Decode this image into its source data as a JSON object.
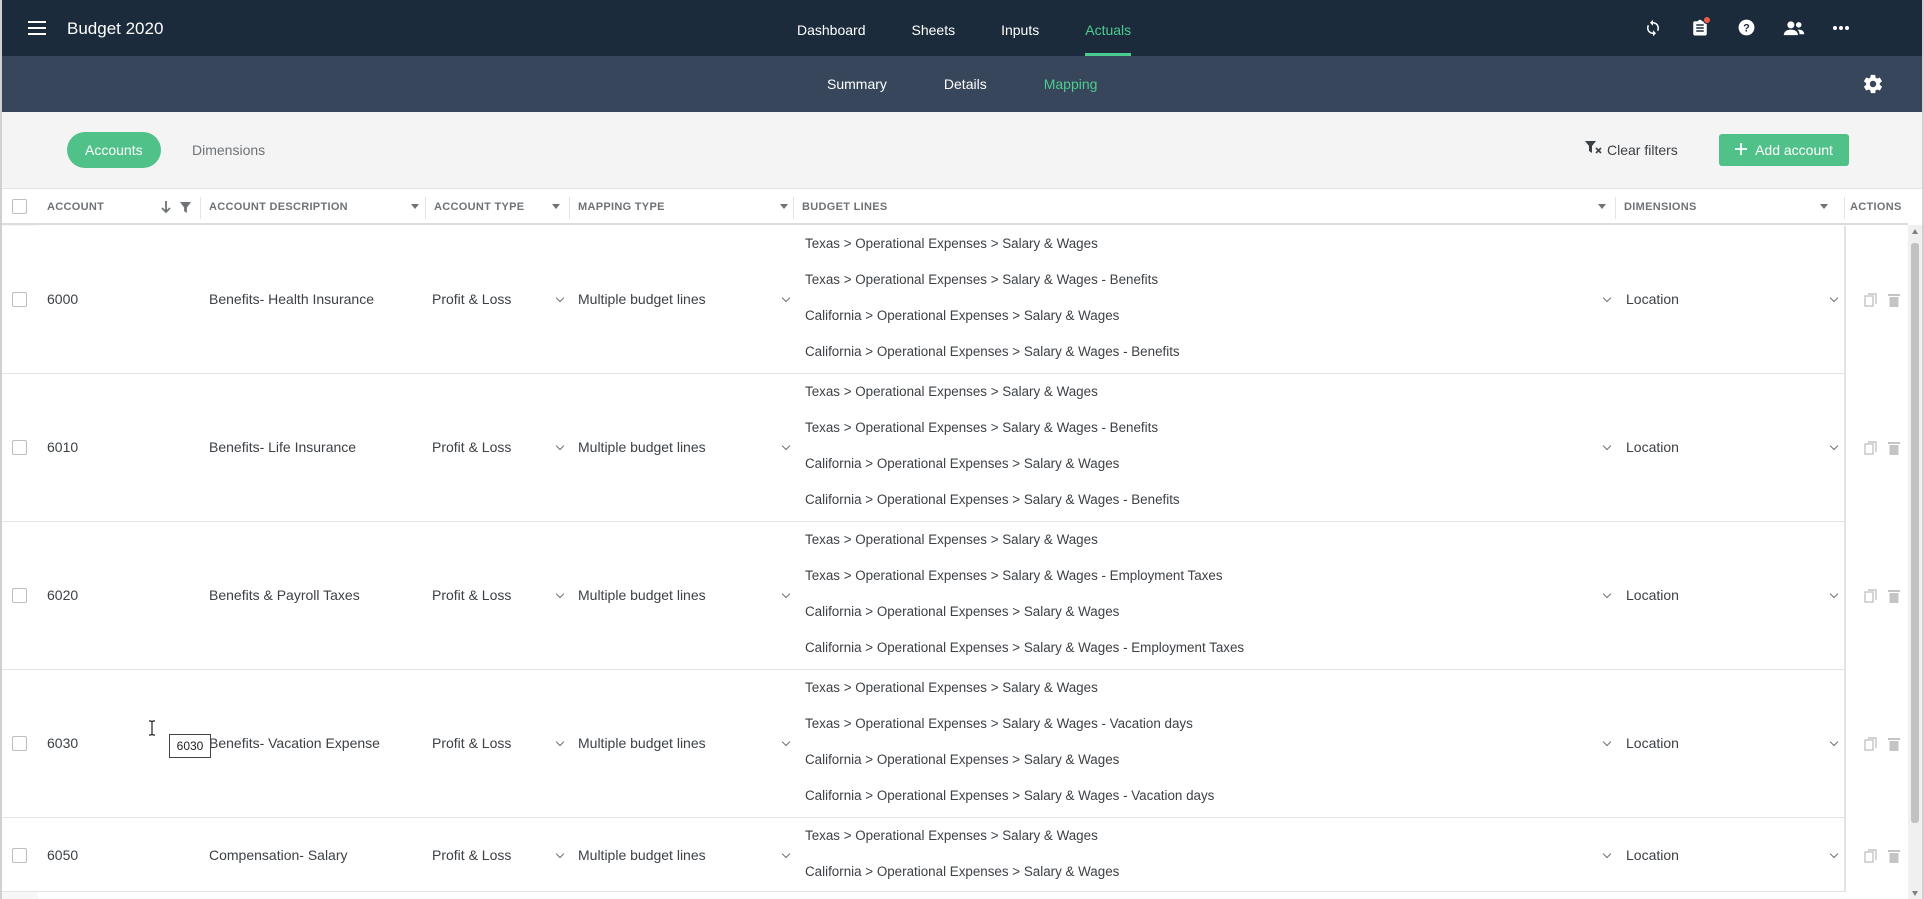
{
  "app": {
    "title": "Budget 2020"
  },
  "topnav": {
    "items": [
      {
        "label": "Dashboard",
        "active": false
      },
      {
        "label": "Sheets",
        "active": false
      },
      {
        "label": "Inputs",
        "active": false
      },
      {
        "label": "Actuals",
        "active": true
      }
    ],
    "icons": [
      "sync-icon",
      "clipboard-icon",
      "help-icon",
      "users-icon",
      "more-icon"
    ]
  },
  "subnav": {
    "items": [
      {
        "label": "Summary",
        "active": false
      },
      {
        "label": "Details",
        "active": false
      },
      {
        "label": "Mapping",
        "active": true
      }
    ]
  },
  "toolbar": {
    "accounts_label": "Accounts",
    "dimensions_label": "Dimensions",
    "clear_filters_label": "Clear filters",
    "add_account_label": "Add account"
  },
  "table": {
    "headers": {
      "account": "ACCOUNT",
      "description": "ACCOUNT DESCRIPTION",
      "type": "ACCOUNT TYPE",
      "mapping": "MAPPING TYPE",
      "budget_lines": "BUDGET LINES",
      "dimensions": "DIMENSIONS",
      "actions": "ACTIONS"
    },
    "rows": [
      {
        "account": "6000",
        "description": "Benefits- Health Insurance",
        "type": "Profit & Loss",
        "mapping": "Multiple budget lines",
        "budget_lines": [
          "Texas > Operational Expenses > Salary & Wages",
          "Texas > Operational Expenses > Salary & Wages - Benefits",
          "California > Operational Expenses > Salary & Wages",
          "California > Operational Expenses > Salary & Wages - Benefits"
        ],
        "dimension": "Location"
      },
      {
        "account": "6010",
        "description": "Benefits- Life Insurance",
        "type": "Profit & Loss",
        "mapping": "Multiple budget lines",
        "budget_lines": [
          "Texas > Operational Expenses > Salary & Wages",
          "Texas > Operational Expenses > Salary & Wages - Benefits",
          "California > Operational Expenses > Salary & Wages",
          "California > Operational Expenses > Salary & Wages - Benefits"
        ],
        "dimension": "Location"
      },
      {
        "account": "6020",
        "description": "Benefits & Payroll Taxes",
        "type": "Profit & Loss",
        "mapping": "Multiple budget lines",
        "budget_lines": [
          "Texas > Operational Expenses > Salary & Wages",
          "Texas > Operational Expenses > Salary & Wages - Employment Taxes",
          "California > Operational Expenses > Salary & Wages",
          "California > Operational Expenses > Salary & Wages - Employment Taxes"
        ],
        "dimension": "Location"
      },
      {
        "account": "6030",
        "description": "Benefits- Vacation Expense",
        "type": "Profit & Loss",
        "mapping": "Multiple budget lines",
        "budget_lines": [
          "Texas > Operational Expenses > Salary & Wages",
          "Texas > Operational Expenses > Salary & Wages - Vacation days",
          "California > Operational Expenses > Salary & Wages",
          "California > Operational Expenses > Salary & Wages - Vacation days"
        ],
        "dimension": "Location"
      },
      {
        "account": "6050",
        "description": "Compensation- Salary",
        "type": "Profit & Loss",
        "mapping": "Multiple budget lines",
        "budget_lines": [
          "Texas > Operational Expenses > Salary & Wages",
          "California > Operational Expenses > Salary & Wages"
        ],
        "dimension": "Location"
      }
    ]
  },
  "tooltip": {
    "text": "6030"
  },
  "colors": {
    "topbar": "#1b2b3b",
    "subbar": "#37465a",
    "accent": "#4fc189",
    "active_nav": "#4ccb8e",
    "notification": "#f15a4a"
  }
}
